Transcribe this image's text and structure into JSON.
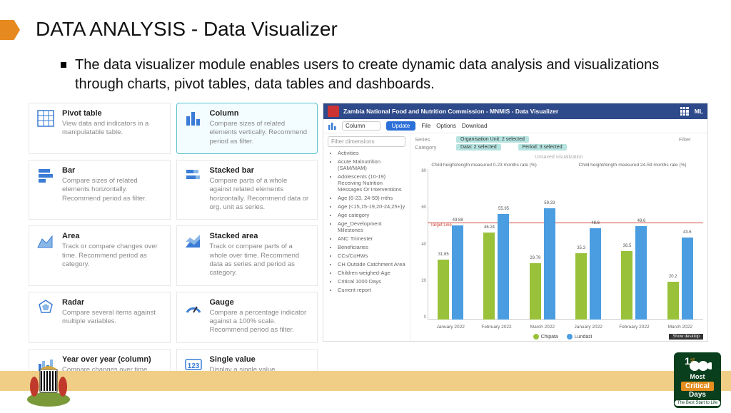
{
  "title": "DATA ANALYSIS - Data Visualizer",
  "bullet": "The data visualizer module enables users to create dynamic data analysis and visualizations through charts, pivot tables, data tables and dashboards.",
  "cards": [
    {
      "h": "Pivot table",
      "d": "View data and indicators in a manipulatable table."
    },
    {
      "h": "Column",
      "d": "Compare sizes of related elements vertically. Recommend period as filter."
    },
    {
      "h": "Bar",
      "d": "Compare sizes of related elements horizontally. Recommend period as filter."
    },
    {
      "h": "Stacked bar",
      "d": "Compare parts of a whole against related elements horizontally. Recommend data or org. unit as series."
    },
    {
      "h": "Area",
      "d": "Track or compare changes over time. Recommend period as category."
    },
    {
      "h": "Stacked area",
      "d": "Track or compare parts of a whole over time. Recommend data as series and period as category."
    },
    {
      "h": "Radar",
      "d": "Compare several items against multiple variables."
    },
    {
      "h": "Gauge",
      "d": "Compare a percentage indicator against a 100% scale. Recommend period as filter."
    },
    {
      "h": "Year over year (column)",
      "d": "Compare changes over time between multiple time periods."
    },
    {
      "h": "Single value",
      "d": "Display a single value. Recommend relative period to show latest data."
    }
  ],
  "app": {
    "header": "Zambia National Food and Nutrition Commission - MNMIS - Data Visualizer",
    "user": "ML",
    "type_sel": "Column",
    "update": "Update",
    "menu": [
      "File",
      "Options",
      "Download"
    ],
    "filter_placeholder": "Filter dimensions",
    "series_lbl": "Series",
    "cat_lbl": "Category",
    "filter_lbl": "Filter",
    "chip_org": "Organisation Unit: 2 selected",
    "chip_data": "Data: 2 selected",
    "chip_period": "Period: 3 selected",
    "unsaved": "Unsaved visualization",
    "dims": [
      "Activities",
      "Acute Malnutrition (SAM/MAM)",
      "Adolescents (10-19) Receiving Nutrition Messages Or Interventions",
      "Age (6-23, 24-59) mths",
      "Age (<15,15-19,20-24,25+)y",
      "Age category",
      "Age_Development Milestones",
      "ANC Trimester",
      "Beneficiaries",
      "CCs/CoHWs",
      "CH Outside Catchment Area",
      "Children weighed-Age",
      "Critical 1000 Days",
      "Current report"
    ],
    "panel_titles": [
      "Child height/length measured 0-23 months rate (%)",
      "Child height/length measured 24-59 months rate (%)"
    ],
    "target_label": "Target Line",
    "legend": [
      "Chipata",
      "Lundazi"
    ],
    "show_desktop": "Show desktop"
  },
  "chart_data": {
    "type": "bar",
    "ylim": [
      0,
      80
    ],
    "yticks": [
      0,
      20,
      40,
      60,
      80
    ],
    "target": 55,
    "categories": [
      "January 2022",
      "February 2022",
      "March 2022",
      "January 2022",
      "February 2022",
      "March 2022"
    ],
    "series": [
      {
        "name": "Chipata",
        "values": [
          31.85,
          46.24,
          29.79,
          35.3,
          36.5,
          20.2
        ]
      },
      {
        "name": "Lundazi",
        "values": [
          49.88,
          55.95,
          59.33,
          48.6,
          49.6,
          43.6
        ]
      }
    ]
  },
  "days_badge": {
    "crit": "Critical",
    "days": "Days",
    "best": "The Best Start to Life"
  }
}
